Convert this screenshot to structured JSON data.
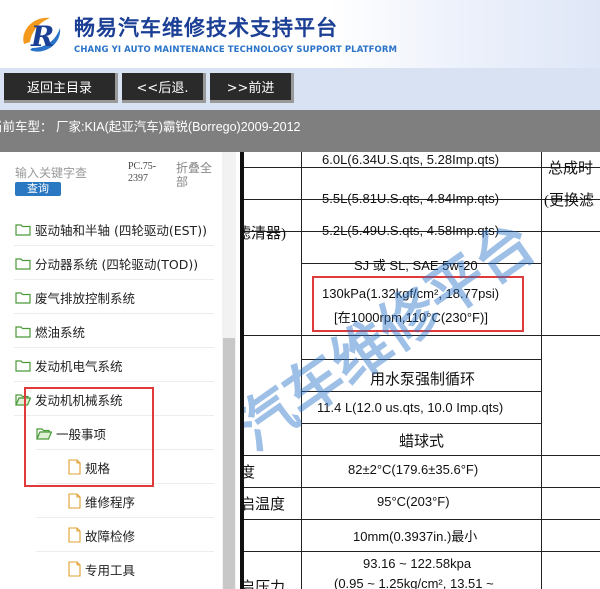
{
  "header": {
    "title_cn": "畅易汽车维修技术支持平台",
    "title_en": "CHANG YI AUTO MAINTENANCE TECHNOLOGY SUPPORT PLATFORM",
    "brand_color": "#1b3f95"
  },
  "nav": {
    "home": "返回主目录",
    "back": "<<后退.",
    "forward": ">>前进"
  },
  "vehicle": {
    "text": "当前车型：  厂家:KIA(起亚汽车)霸锐(Borrego)2009-2012"
  },
  "sidebar": {
    "search_placeholder": "输入关键字查",
    "search_button": "查询",
    "pc_code": "PC.75-2397",
    "fold_all": "折叠全部",
    "items": [
      {
        "label": "驱动轴和半轴 (四轮驱动(EST))",
        "icon": "folder-icon"
      },
      {
        "label": "分动器系统 (四轮驱动(TOD))",
        "icon": "folder-icon"
      },
      {
        "label": "废气排放控制系统",
        "icon": "folder-icon"
      },
      {
        "label": "燃油系统",
        "icon": "folder-icon"
      },
      {
        "label": "发动机电气系统",
        "icon": "folder-icon"
      },
      {
        "label": "发动机机械系统",
        "icon": "folder-open-icon"
      },
      {
        "label": "一般事项",
        "icon": "folder-open-icon"
      },
      {
        "label": "规格",
        "icon": "document-icon"
      },
      {
        "label": "维修程序",
        "icon": "document-icon"
      },
      {
        "label": "故障检修",
        "icon": "document-icon"
      },
      {
        "label": "专用工具",
        "icon": "document-icon"
      }
    ]
  },
  "content": {
    "rows": [
      {
        "left": "",
        "center": "6.0L(6.34U.S.qts, 5.28Imp.qts)",
        "right": "总成时"
      },
      {
        "left": "",
        "center": "5.5L(5.81U.S.qts, 4.84Imp.qts)",
        "right": "(更换滤"
      },
      {
        "left": "滤清器)",
        "center": "5.2L(5.49U.S.qts, 4.58Imp.qts)",
        "right": ""
      },
      {
        "left": "",
        "center": "SJ 或 SL, SAE 5w-20",
        "right": ""
      },
      {
        "left": "",
        "center": "130kPa(1.32kgf/cm², 18.77psi)",
        "center2": "[在1000rpm,110°C(230°F)]",
        "right": ""
      },
      {
        "left": "",
        "center": "",
        "right": ""
      },
      {
        "left": "",
        "center": "用水泵强制循环",
        "right": ""
      },
      {
        "left": "",
        "center": "11.4 L(12.0 us.qts, 10.0 Imp.qts)",
        "right": ""
      },
      {
        "left": "",
        "center": "蜡球式",
        "right": ""
      },
      {
        "left": "度",
        "center": "82±2°C(179.6±35.6°F)",
        "right": ""
      },
      {
        "left": "启温度",
        "center": "95°C(203°F)",
        "right": ""
      },
      {
        "left": "",
        "center": "10mm(0.3937in.)最小",
        "right": ""
      },
      {
        "left": "启压力",
        "center": "93.16 ~ 122.58kpa",
        "center2": "(0.95 ~ 1.25kg/cm², 13.51 ~",
        "right": ""
      }
    ],
    "watermark": "汽车维修平台",
    "highlight_color": "#e03a3a"
  }
}
